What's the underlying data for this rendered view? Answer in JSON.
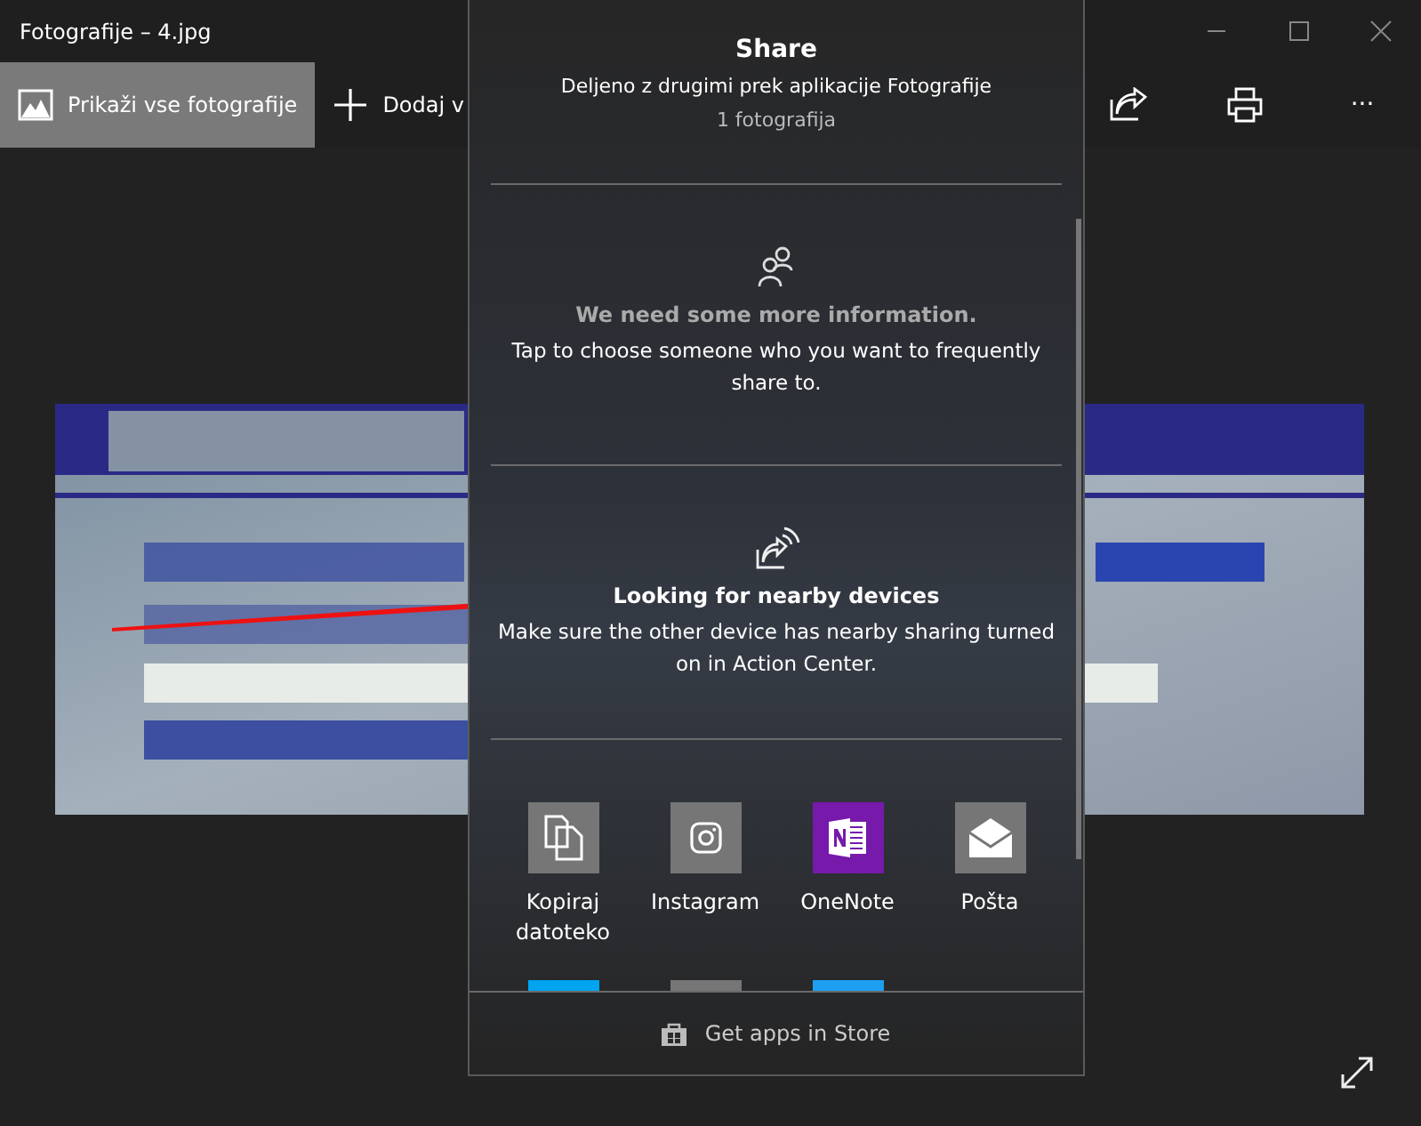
{
  "window": {
    "title": "Fotografije – 4.jpg"
  },
  "toolbar": {
    "left": [
      {
        "kind": "gallery",
        "label": "Prikaži vse fotografije",
        "selected": true
      },
      {
        "kind": "add",
        "label": "Dodaj v",
        "selected": false
      }
    ],
    "right": [
      {
        "kind": "share"
      },
      {
        "kind": "print"
      },
      {
        "kind": "more",
        "label": "···"
      }
    ]
  },
  "share": {
    "title": "Share",
    "subtitle": "Deljeno z drugimi prek aplikacije Fotografije",
    "count": "1 fotografija",
    "sections": [
      {
        "kind": "people",
        "heading": "We need some more information.",
        "text": "Tap to choose someone who you want to frequently share to.",
        "emphasis": false
      },
      {
        "kind": "nearby",
        "heading": "Looking for nearby devices",
        "text": "Make sure the other device has nearby sharing turned on in Action Center.",
        "emphasis": true
      }
    ],
    "apps": [
      {
        "kind": "copy",
        "label": "Kopiraj datoteko",
        "color": "#767676"
      },
      {
        "kind": "instagram",
        "label": "Instagram",
        "color": "#767676"
      },
      {
        "kind": "onenote",
        "label": "OneNote",
        "color": "#7719aa"
      },
      {
        "kind": "mail",
        "label": "Pošta",
        "color": "#767676"
      },
      {
        "kind": "blank",
        "color": "#00a4ef"
      },
      {
        "kind": "blank",
        "color": "#767676"
      },
      {
        "kind": "blank",
        "color": "#1e9ff2"
      }
    ],
    "footer": "Get apps in Store"
  }
}
